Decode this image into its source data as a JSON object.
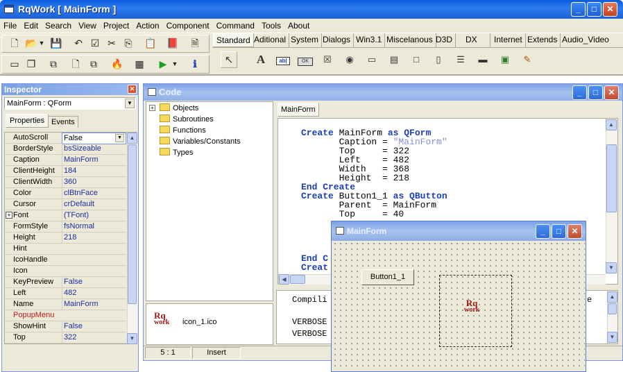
{
  "app": {
    "title": "RqWork [ MainForm ]"
  },
  "menu": [
    "File",
    "Edit",
    "Search",
    "View",
    "Project",
    "Action",
    "Component",
    "Command",
    "Tools",
    "About"
  ],
  "palette_tabs": [
    "Standard",
    "Aditional",
    "System",
    "Dialogs",
    "Win3.1",
    "Miscelanous",
    "D3D",
    "DX",
    "Internet",
    "Extends",
    "Audio_Video"
  ],
  "inspector": {
    "title": "Inspector",
    "object_select": "MainForm : QForm",
    "tabs": [
      "Properties",
      "Events"
    ],
    "properties": [
      {
        "k": "AutoScroll",
        "v": "False"
      },
      {
        "k": "BorderStyle",
        "v": "bsSizeable"
      },
      {
        "k": "Caption",
        "v": "MainForm"
      },
      {
        "k": "ClientHeight",
        "v": "184"
      },
      {
        "k": "ClientWidth",
        "v": "360"
      },
      {
        "k": "Color",
        "v": "clBtnFace"
      },
      {
        "k": "Cursor",
        "v": "crDefault"
      },
      {
        "k": "Font",
        "v": "(TFont)"
      },
      {
        "k": "FormStyle",
        "v": "fsNormal"
      },
      {
        "k": "Height",
        "v": "218"
      },
      {
        "k": "Hint",
        "v": ""
      },
      {
        "k": "IcoHandle",
        "v": ""
      },
      {
        "k": "Icon",
        "v": ""
      },
      {
        "k": "KeyPreview",
        "v": "False"
      },
      {
        "k": "Left",
        "v": "482"
      },
      {
        "k": "Name",
        "v": "MainForm"
      },
      {
        "k": "PopupMenu",
        "v": ""
      },
      {
        "k": "ShowHint",
        "v": "False"
      },
      {
        "k": "Top",
        "v": "322"
      }
    ],
    "font_expander": "+"
  },
  "code": {
    "title": "Code",
    "tree": [
      "Objects",
      "Subroutines",
      "Functions",
      "Variables/Constants",
      "Types"
    ],
    "tree_expander": "+",
    "editor_tab": "MainForm",
    "lines": [
      {
        "kw": "Create",
        "rest": " MainForm ",
        "kw2": "as",
        "tail": " QForm"
      },
      {
        "indent": "       ",
        "name": "Caption",
        "op": " = ",
        "str": "\"MainForm\""
      },
      {
        "indent": "       ",
        "name": "Top    ",
        "op": " = ",
        "val": "322"
      },
      {
        "indent": "       ",
        "name": "Left   ",
        "op": " = ",
        "val": "482"
      },
      {
        "indent": "       ",
        "name": "Width  ",
        "op": " = ",
        "val": "368"
      },
      {
        "indent": "       ",
        "name": "Height ",
        "op": " = ",
        "val": "218"
      },
      {
        "kw": "End Create"
      },
      {
        "kw": "Create",
        "rest": " Button1_1 ",
        "kw2": "as",
        "tail": " QButton"
      },
      {
        "indent": "       ",
        "name": "Parent ",
        "op": " = ",
        "val": "MainForm"
      },
      {
        "indent": "       ",
        "name": "Top    ",
        "op": " = ",
        "val": "40"
      }
    ],
    "hidden_lines": [
      "End C",
      "Creat"
    ],
    "icon_file": "icon_1.ico",
    "output": [
      "Compili",
      "VERBOSE",
      "VERBOSE"
    ],
    "output_right": "e",
    "status_pos": "5 : 1",
    "status_mode": "Insert"
  },
  "form": {
    "title": "MainForm",
    "button": "Button1_1"
  },
  "logo": {
    "line1": "Rq",
    "line2": "work"
  }
}
